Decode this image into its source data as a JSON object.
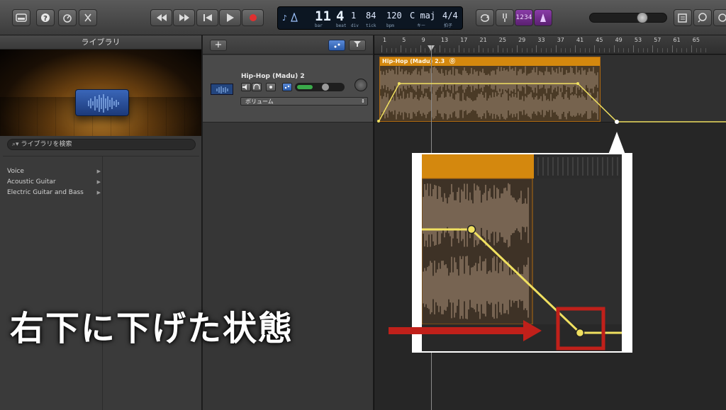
{
  "toolbar": {
    "buttons": [
      "library-button",
      "help-button",
      "smart-controls-button",
      "editors-button"
    ],
    "transport": [
      "rewind",
      "fast-forward",
      "go-to-beginning",
      "play",
      "record"
    ],
    "lcd": {
      "bar": "11",
      "bar_label": "bar",
      "beat": "4",
      "beat_label": "beat",
      "div": "1",
      "div_label": "div",
      "tick": "84",
      "tick_label": "tick",
      "tempo": "120",
      "tempo_label": "bpm",
      "key": "C maj",
      "key_label": "キー",
      "sig": "4/4",
      "sig_label": "拍子"
    },
    "count_in": "1234"
  },
  "library": {
    "title": "ライブラリ",
    "search_placeholder": "ライブラリを検索",
    "items": [
      {
        "label": "Voice"
      },
      {
        "label": "Acoustic Guitar"
      },
      {
        "label": "Electric Guitar and Bass"
      }
    ]
  },
  "track": {
    "add": "+",
    "name": "Hip-Hop (Madu) 2",
    "automation": "ボリューム"
  },
  "timeline": {
    "ruler": [
      "1",
      "5",
      "9",
      "13",
      "17",
      "21",
      "25",
      "29",
      "33",
      "37",
      "41",
      "45",
      "49",
      "53",
      "57",
      "61",
      "65"
    ],
    "region_name": "Hip-Hop (Madu) 2.3"
  },
  "annotation": {
    "caption": "右下に下げた状態",
    "arrow_color": "#c0201a",
    "highlight_color": "#c0201a"
  },
  "colors": {
    "region_header": "#d4880e",
    "automation_line": "#f0e060"
  }
}
